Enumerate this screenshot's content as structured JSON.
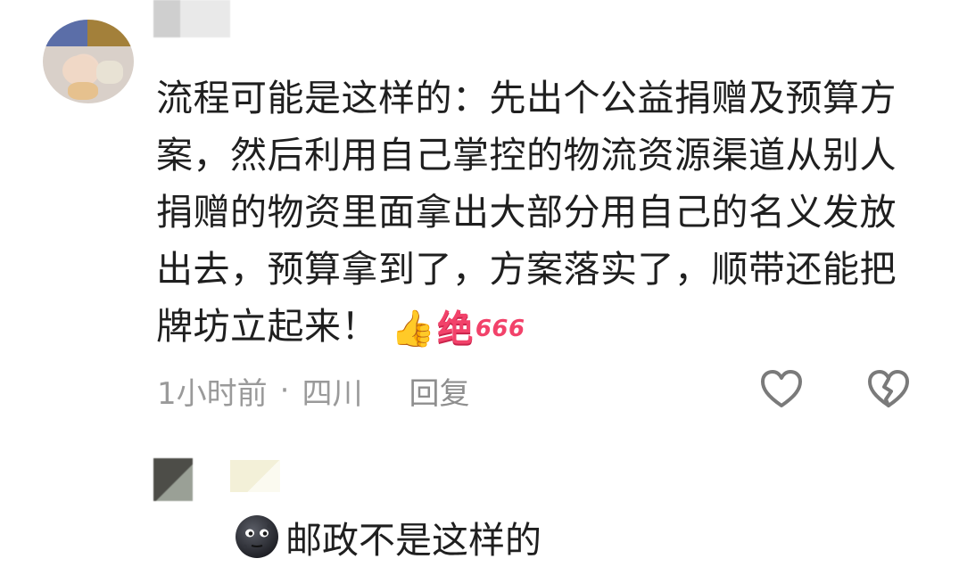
{
  "comment": {
    "text": "流程可能是这样的：先出个公益捐赠及预算方案，然后利用自己掌控的物流资源渠道从别人捐赠的物资里面拿出大部分用自己的名义发放出去，预算拿到了，方案落实了，顺带还能把牌坊立起来！",
    "sticker": {
      "icon": "thumbs-up-icon",
      "word": "绝",
      "number": "666"
    },
    "time": "1小时前",
    "separator": "·",
    "location": "四川",
    "reply_label": "回复",
    "like_icon": "heart-outline-icon",
    "dislike_icon": "broken-heart-icon"
  },
  "reply": {
    "emoji_icon": "new-moon-face-icon",
    "text": "邮政不是这样的"
  },
  "colors": {
    "text": "#1f1f1f",
    "meta": "#9a9a9a",
    "sticker": "#f2426a",
    "icon": "#7a7a7a"
  }
}
